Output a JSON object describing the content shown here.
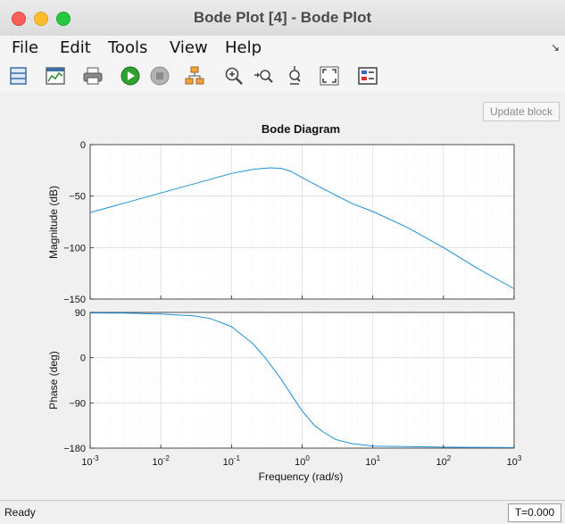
{
  "window": {
    "title": "Bode Plot [4] - Bode Plot"
  },
  "menu": {
    "items": [
      "File",
      "Edit",
      "Tools",
      "View",
      "Help"
    ]
  },
  "toolbar": {
    "icons": [
      "layout-icon",
      "figure-icon",
      "print-icon",
      "run-icon",
      "stop-icon",
      "blocks-icon",
      "zoom-in-icon",
      "zoom-x-icon",
      "zoom-y-icon",
      "fit-view-icon",
      "legend-icon"
    ]
  },
  "update_button": "Update block",
  "status": {
    "text": "Ready",
    "time": "T=0.000"
  },
  "chart_data": {
    "type": "line",
    "title": "Bode Diagram",
    "xlabel": "Frequency  (rad/s)",
    "x_scale": "log",
    "xlim": [
      0.001,
      1000
    ],
    "x_ticks": [
      {
        "base": "10",
        "exp": "-3"
      },
      {
        "base": "10",
        "exp": "-2"
      },
      {
        "base": "10",
        "exp": "-1"
      },
      {
        "base": "10",
        "exp": "0"
      },
      {
        "base": "10",
        "exp": "1"
      },
      {
        "base": "10",
        "exp": "2"
      },
      {
        "base": "10",
        "exp": "3"
      }
    ],
    "magnitude": {
      "ylabel": "Magnitude (dB)",
      "ylim": [
        -150,
        0
      ],
      "yticks": [
        "0",
        "-50",
        "-100",
        "-150"
      ],
      "x": [
        0.001,
        0.003,
        0.01,
        0.03,
        0.1,
        0.2,
        0.35,
        0.5,
        0.7,
        1,
        2,
        5,
        10,
        30,
        100,
        300,
        1000
      ],
      "y": [
        -66,
        -57,
        -47,
        -38,
        -28,
        -24,
        -22.5,
        -23,
        -26,
        -32,
        -43,
        -57,
        -65,
        -80,
        -100,
        -120,
        -140
      ]
    },
    "phase": {
      "ylabel": "Phase (deg)",
      "ylim": [
        -180,
        90
      ],
      "yticks": [
        "90",
        "0",
        "-90",
        "-180"
      ],
      "x": [
        0.001,
        0.003,
        0.01,
        0.03,
        0.05,
        0.1,
        0.2,
        0.3,
        0.5,
        0.7,
        1,
        1.5,
        2,
        3,
        5,
        10,
        30,
        100,
        1000
      ],
      "y": [
        89,
        88.5,
        87,
        83,
        78,
        62,
        28,
        0,
        -42,
        -73,
        -106,
        -135,
        -148,
        -163,
        -171,
        -176,
        -177,
        -178,
        -179
      ]
    },
    "grid": true,
    "line_color": "#1f8fd6"
  }
}
